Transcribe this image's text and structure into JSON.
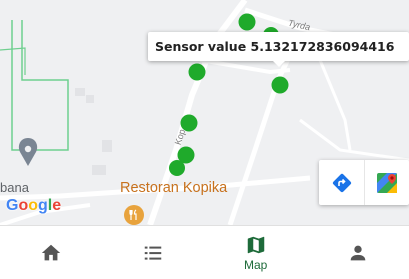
{
  "map": {
    "tooltip_text": "Sensor value 5.132172836094416",
    "poi_name": "Restoran Kopika",
    "place_label": "bana",
    "street_top": "Tyrda",
    "street_side": "Kop",
    "google_logo": [
      "G",
      "o",
      "o",
      "g",
      "l",
      "e"
    ],
    "marker_color": "#1faa2b"
  },
  "map_controls": {
    "directions_icon": "directions-icon",
    "open_maps_icon": "google-maps-icon"
  },
  "bottom_nav": {
    "items": [
      {
        "icon": "home-icon",
        "label": ""
      },
      {
        "icon": "list-icon",
        "label": ""
      },
      {
        "icon": "map-icon",
        "label": "Map",
        "active": true
      },
      {
        "icon": "person-icon",
        "label": ""
      }
    ],
    "active_color": "#1e6b3a",
    "inactive_color": "#555555"
  }
}
